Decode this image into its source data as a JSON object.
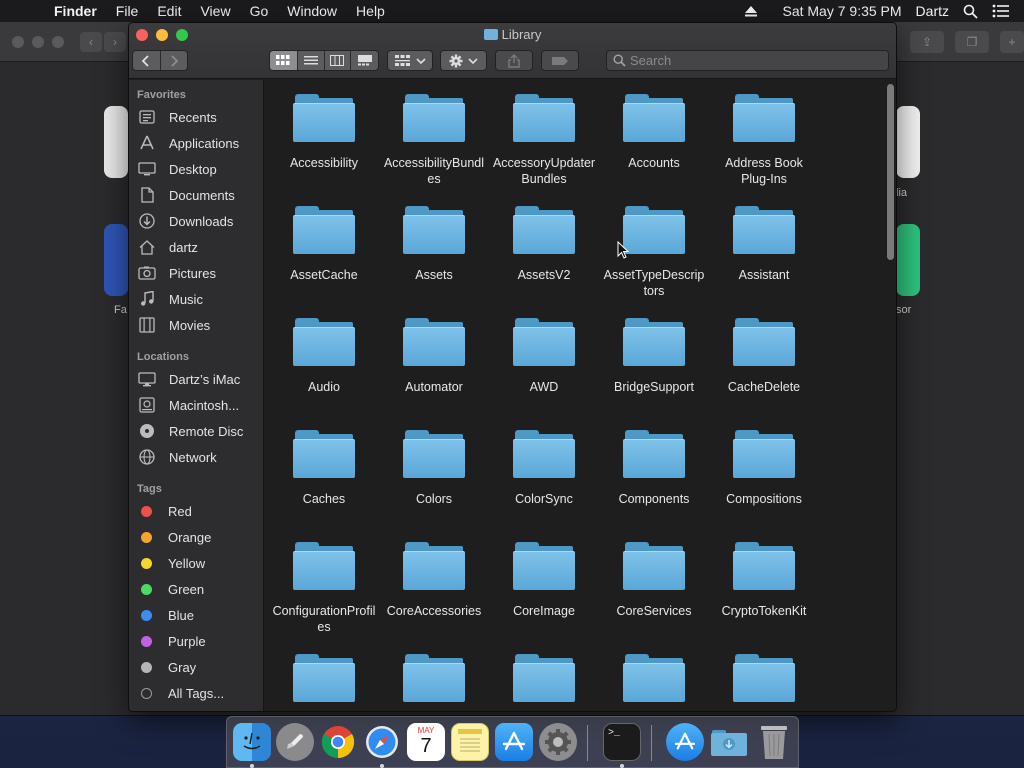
{
  "menubar": {
    "apple": "",
    "app_name": "Finder",
    "menus": [
      "File",
      "Edit",
      "View",
      "Go",
      "Window",
      "Help"
    ],
    "datetime": "Sat May 7  9:35 PM",
    "user": "Dartz"
  },
  "background_window": {
    "labels": [
      "Fa",
      "lia",
      "sor"
    ]
  },
  "finder": {
    "title": "Library",
    "search_placeholder": "Search",
    "sidebar": {
      "favorites_heading": "Favorites",
      "favorites": [
        {
          "label": "Recents",
          "icon": "recents-icon"
        },
        {
          "label": "Applications",
          "icon": "applications-icon"
        },
        {
          "label": "Desktop",
          "icon": "desktop-icon"
        },
        {
          "label": "Documents",
          "icon": "documents-icon"
        },
        {
          "label": "Downloads",
          "icon": "downloads-icon"
        },
        {
          "label": "dartz",
          "icon": "home-icon"
        },
        {
          "label": "Pictures",
          "icon": "pictures-icon"
        },
        {
          "label": "Music",
          "icon": "music-icon"
        },
        {
          "label": "Movies",
          "icon": "movies-icon"
        }
      ],
      "locations_heading": "Locations",
      "locations": [
        {
          "label": "Dartz’s iMac",
          "icon": "imac-icon"
        },
        {
          "label": "Macintosh...",
          "icon": "hard-drive-icon"
        },
        {
          "label": "Remote Disc",
          "icon": "disc-icon"
        },
        {
          "label": "Network",
          "icon": "network-icon"
        }
      ],
      "tags_heading": "Tags",
      "tags": [
        {
          "label": "Red",
          "color": "#f0504a"
        },
        {
          "label": "Orange",
          "color": "#f5a52e"
        },
        {
          "label": "Yellow",
          "color": "#f5d82e"
        },
        {
          "label": "Green",
          "color": "#4cd964"
        },
        {
          "label": "Blue",
          "color": "#3b8ef0"
        },
        {
          "label": "Purple",
          "color": "#c163e0"
        },
        {
          "label": "Gray",
          "color": "#b5b5b5"
        },
        {
          "label": "All Tags...",
          "color": "all-tags"
        }
      ]
    },
    "folders": [
      "Accessibility",
      "AccessibilityBundles",
      "AccessoryUpdaterBundles",
      "Accounts",
      "Address Book Plug-Ins",
      "AssetCache",
      "Assets",
      "AssetsV2",
      "AssetTypeDescriptors",
      "Assistant",
      "Audio",
      "Automator",
      "AWD",
      "BridgeSupport",
      "CacheDelete",
      "Caches",
      "Colors",
      "ColorSync",
      "Components",
      "Compositions",
      "ConfigurationProfiles",
      "CoreAccessories",
      "CoreImage",
      "CoreServices",
      "CryptoTokenKit",
      "",
      "",
      "",
      "",
      ""
    ]
  },
  "dock": {
    "apps": [
      "Finder",
      "Launchpad",
      "Chrome",
      "Safari",
      "Calendar",
      "Notes",
      "App Store",
      "System Preferences",
      "Terminal",
      "Applications",
      "Downloads",
      "Trash"
    ],
    "calendar_month": "MAY",
    "calendar_day": "7"
  }
}
